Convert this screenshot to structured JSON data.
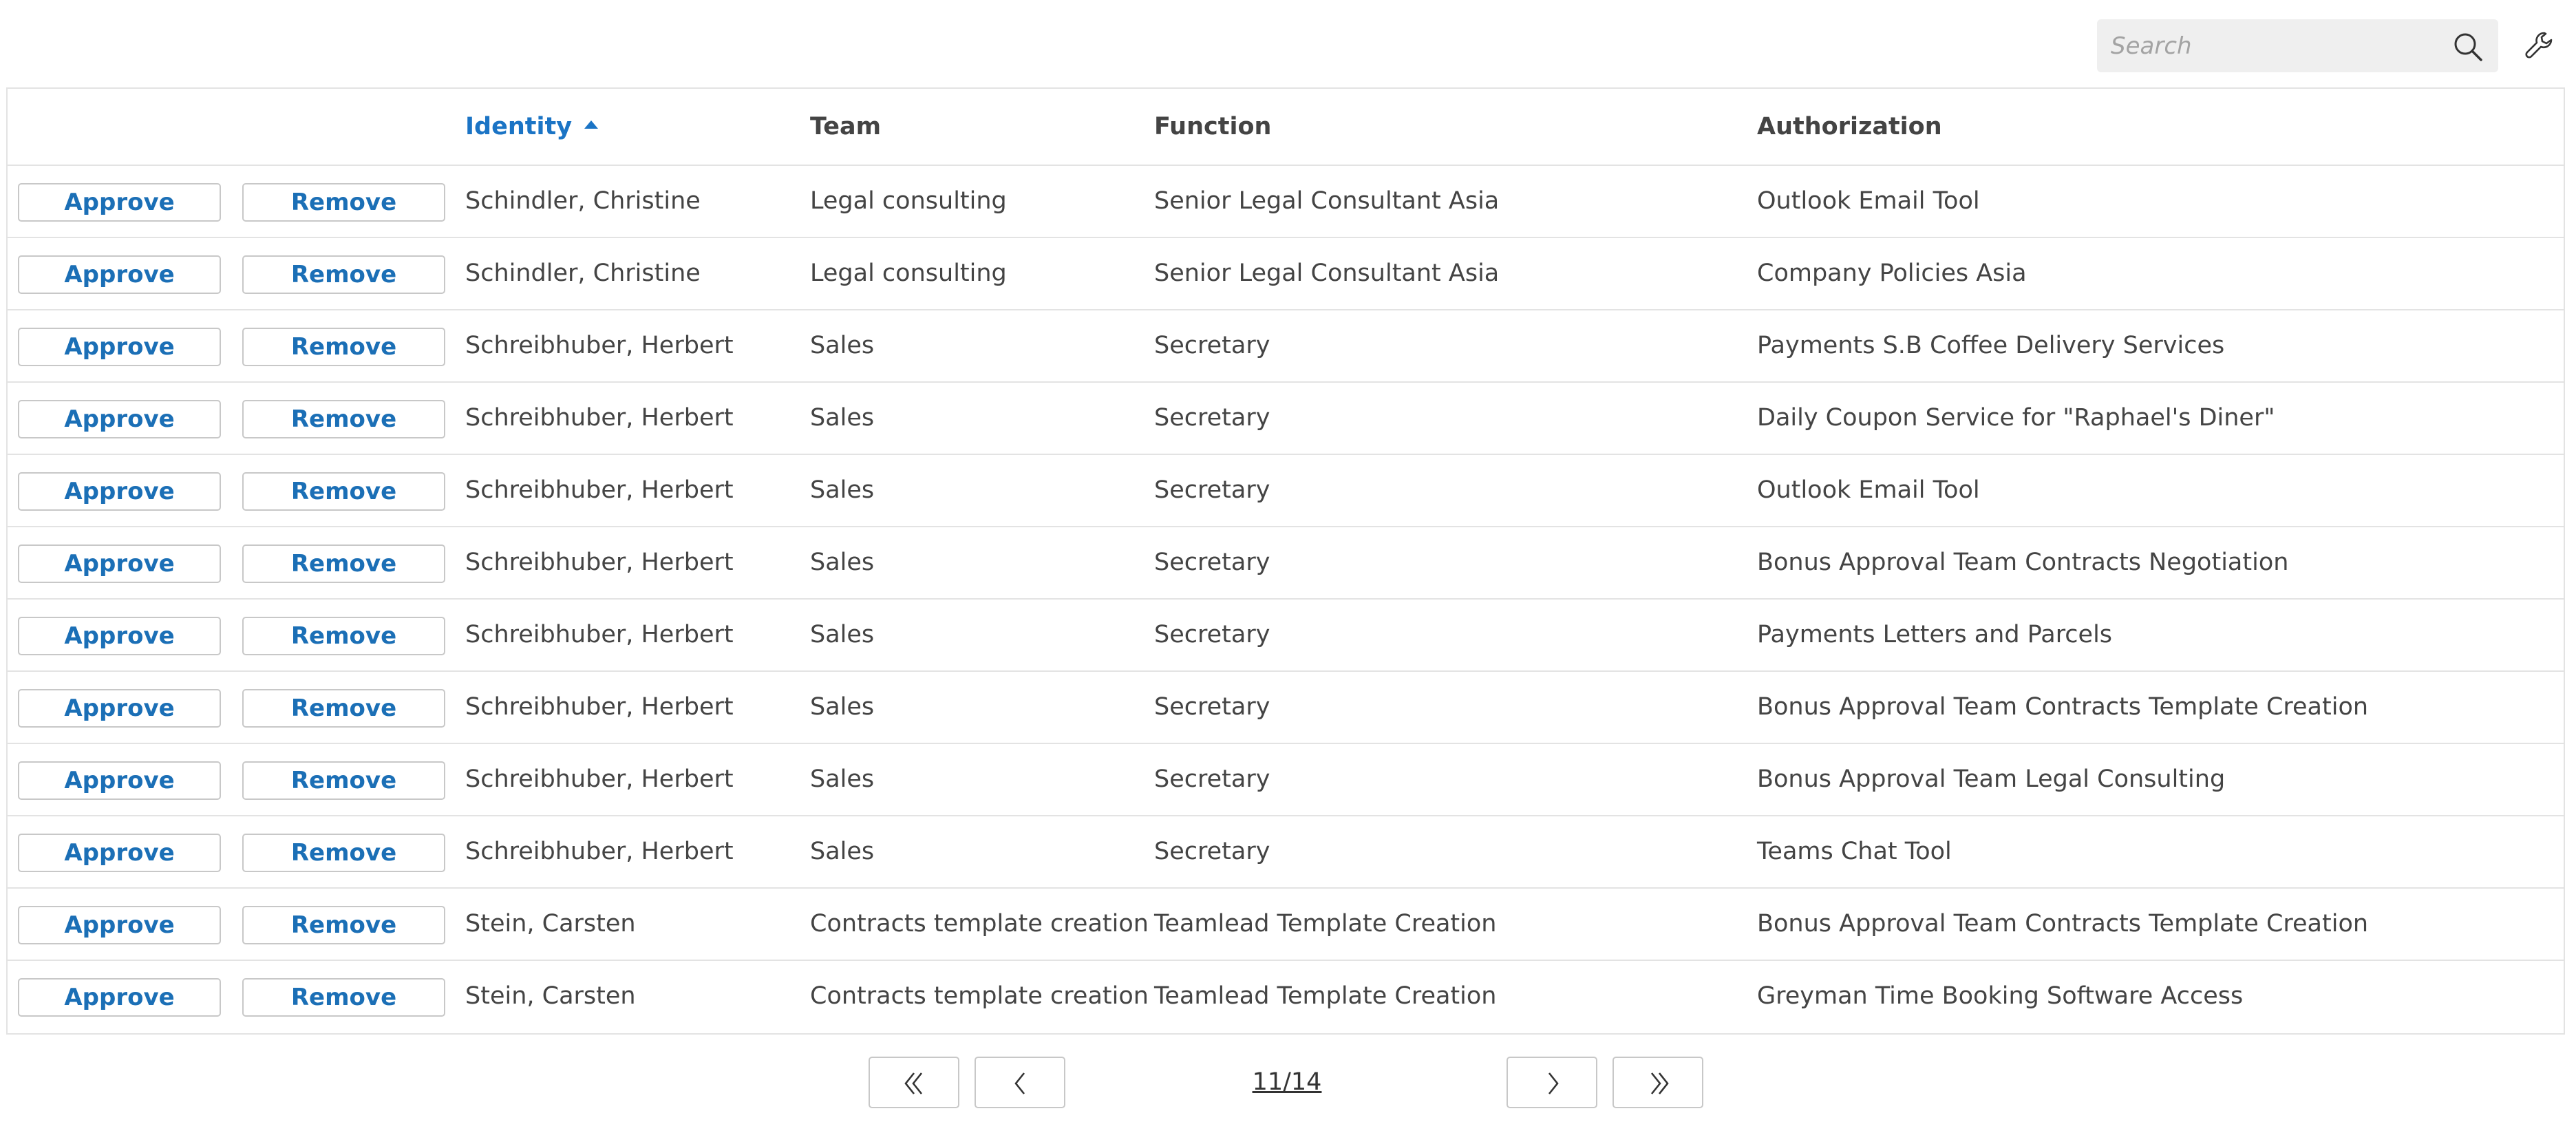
{
  "search": {
    "placeholder": "Search",
    "value": ""
  },
  "icons": {
    "search": "search-icon",
    "settings": "wrench-icon",
    "sort": "sort-ascending-icon",
    "first_page": "double-chevron-left-icon",
    "prev_page": "chevron-left-icon",
    "next_page": "chevron-right-icon",
    "last_page": "double-chevron-right-icon"
  },
  "colors": {
    "accent": "#1b74c5",
    "button_text": "#1b6fb6",
    "border": "#e3e3e3",
    "search_bg": "#efefef"
  },
  "table": {
    "columns": {
      "identity": "Identity",
      "team": "Team",
      "function": "Function",
      "authorization": "Authorization"
    },
    "sorted_column": "Identity",
    "sort_direction": "ascending",
    "approve_label": "Approve",
    "remove_label": "Remove",
    "rows": [
      {
        "identity": "Schindler, Christine",
        "team": "Legal consulting",
        "function": "Senior Legal Consultant Asia",
        "authorization": "Outlook Email Tool"
      },
      {
        "identity": "Schindler, Christine",
        "team": "Legal consulting",
        "function": "Senior Legal Consultant Asia",
        "authorization": "Company Policies Asia"
      },
      {
        "identity": "Schreibhuber, Herbert",
        "team": "Sales",
        "function": "Secretary",
        "authorization": "Payments S.B Coffee Delivery Services"
      },
      {
        "identity": "Schreibhuber, Herbert",
        "team": "Sales",
        "function": "Secretary",
        "authorization": "Daily Coupon Service for \"Raphael's Diner\""
      },
      {
        "identity": "Schreibhuber, Herbert",
        "team": "Sales",
        "function": "Secretary",
        "authorization": "Outlook Email Tool"
      },
      {
        "identity": "Schreibhuber, Herbert",
        "team": "Sales",
        "function": "Secretary",
        "authorization": "Bonus Approval Team Contracts Negotiation"
      },
      {
        "identity": "Schreibhuber, Herbert",
        "team": "Sales",
        "function": "Secretary",
        "authorization": "Payments Letters and Parcels"
      },
      {
        "identity": "Schreibhuber, Herbert",
        "team": "Sales",
        "function": "Secretary",
        "authorization": "Bonus Approval Team Contracts Template Creation"
      },
      {
        "identity": "Schreibhuber, Herbert",
        "team": "Sales",
        "function": "Secretary",
        "authorization": "Bonus Approval Team Legal Consulting"
      },
      {
        "identity": "Schreibhuber, Herbert",
        "team": "Sales",
        "function": "Secretary",
        "authorization": "Teams Chat Tool"
      },
      {
        "identity": "Stein, Carsten",
        "team": "Contracts template creation",
        "function": "Teamlead Template Creation",
        "authorization": "Bonus Approval Team Contracts Template Creation"
      },
      {
        "identity": "Stein, Carsten",
        "team": "Contracts template creation",
        "function": "Teamlead Template Creation",
        "authorization": "Greyman Time Booking Software Access"
      }
    ]
  },
  "pagination": {
    "current_page": 11,
    "total_pages": 14,
    "label": "11/14"
  }
}
